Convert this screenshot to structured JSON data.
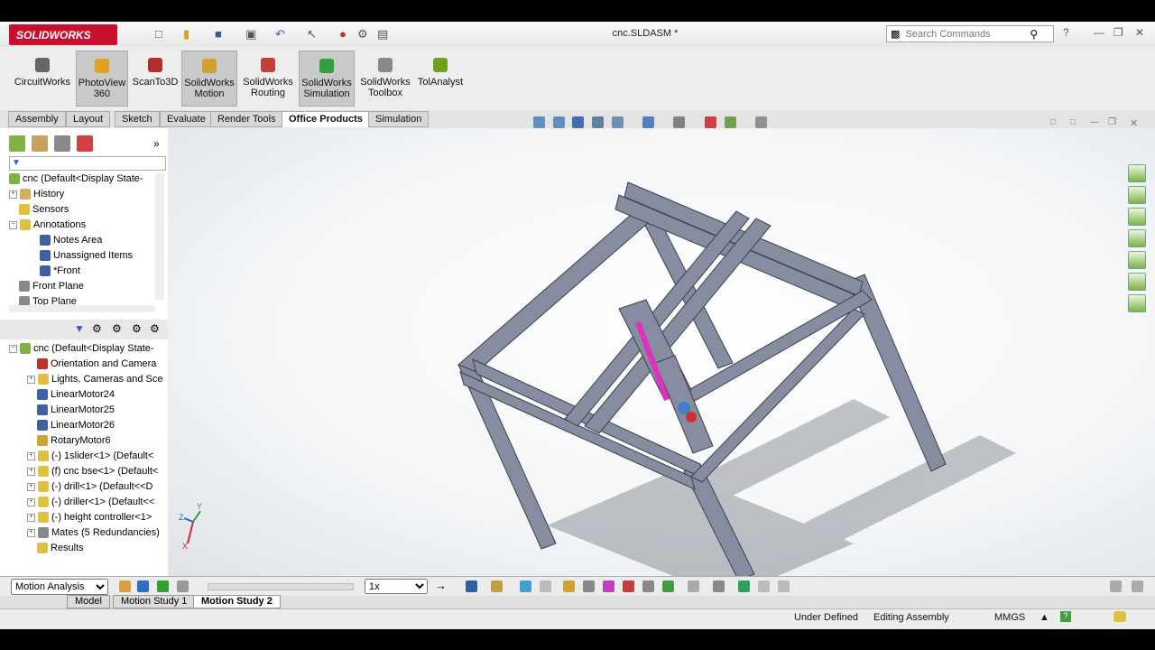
{
  "app": {
    "brand": "SOLIDWORKS",
    "document_title": "cnc.SLDASM *"
  },
  "search": {
    "placeholder": "Search Commands"
  },
  "ribbon": [
    {
      "label": "CircuitWorks",
      "icon": "circuitworks-icon",
      "color": "#666666"
    },
    {
      "label": "PhotoView 360",
      "icon": "photoview-icon",
      "color": "#e0a020"
    },
    {
      "label": "ScanTo3D",
      "icon": "scanto3d-icon",
      "color": "#b03030"
    },
    {
      "label": "SolidWorks Motion",
      "icon": "motion-icon",
      "color": "#d0a030"
    },
    {
      "label": "SolidWorks Routing",
      "icon": "routing-icon",
      "color": "#c04040"
    },
    {
      "label": "SolidWorks Simulation",
      "icon": "simulation-icon",
      "color": "#30a040"
    },
    {
      "label": "SolidWorks Toolbox",
      "icon": "toolbox-icon",
      "color": "#888888"
    },
    {
      "label": "TolAnalyst",
      "icon": "tolanalyst-icon",
      "color": "#70a020"
    }
  ],
  "tabs": [
    "Assembly",
    "Layout",
    "Sketch",
    "Evaluate",
    "Render Tools",
    "Office Products",
    "Simulation"
  ],
  "active_tab": "Office Products",
  "feature_tree": {
    "root": "cnc  (Default<Display State-",
    "items": [
      "History",
      "Sensors",
      "Annotations",
      "Notes Area",
      "Unassigned Items",
      "*Front",
      "Front Plane",
      "Top Plane"
    ]
  },
  "motion_tree": {
    "root": "cnc  (Default<Display State-",
    "items": [
      "Orientation and Camera",
      "Lights, Cameras and Sce",
      "LinearMotor24",
      "LinearMotor25",
      "LinearMotor26",
      "RotaryMotor6",
      "(-) 1slider<1> (Default<",
      "(f) cnc bse<1> (Default<",
      "(-) drill<1> (Default<<D",
      "(-) driller<1> (Default<<",
      "(-) height controller<1>",
      "Mates (5 Redundancies)",
      "Results"
    ]
  },
  "motion_study": {
    "type": "Motion Analysis",
    "speed": "1x"
  },
  "bottom_tabs": [
    "Model",
    "Motion Study 1",
    "Motion Study 2"
  ],
  "active_bottom_tab": "Motion Study 2",
  "status": {
    "state": "Under Defined",
    "mode": "Editing Assembly",
    "units": "MMGS"
  },
  "triad": {
    "z": "Z",
    "y": "Y",
    "x": "X"
  },
  "colors": {
    "brand": "#c8102e",
    "frame": "#7a8090",
    "highlight": "#e030c0"
  }
}
